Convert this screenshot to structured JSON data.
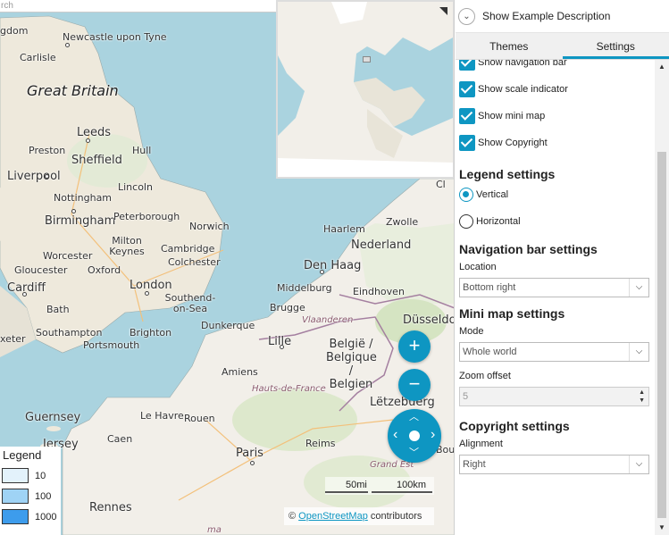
{
  "map": {
    "search_placeholder": "rch",
    "labels": {
      "great_britain": "Great Britain",
      "kingdom": "gdom",
      "newcastle": "Newcastle upon Tyne",
      "carlisle": "Carlisle",
      "leeds": "Leeds",
      "sheffield": "Sheffield",
      "preston": "Preston",
      "hull": "Hull",
      "liverpool": "Liverpool",
      "lincoln": "Lincoln",
      "nottingham": "Nottingham",
      "birmingham": "Birmingham",
      "peterborough": "Peterborough",
      "norwich": "Norwich",
      "milton_keynes": "Milton Keynes",
      "cambridge": "Cambridge",
      "worcester": "Worcester",
      "colchester": "Colchester",
      "gloucester": "Gloucester",
      "oxford": "Oxford",
      "cardiff": "Cardiff",
      "london": "London",
      "southend": "Southend-on-Sea",
      "bath": "Bath",
      "southampton": "Southampton",
      "brighton": "Brighton",
      "portsmouth": "Portsmouth",
      "dunkerque": "Dunkerque",
      "lille": "Lille",
      "belgie": "België / Belgique / Belgien",
      "vlaanderen": "Vlaanderen",
      "brugge": "Brugge",
      "middelburg": "Middelburg",
      "den_haag": "Den Haag",
      "nederland": "Nederland",
      "haarlem": "Haarlem",
      "zwolle": "Zwolle",
      "eindhoven": "Eindhoven",
      "dusseldorf": "Düsseldorf",
      "letzebuerg": "Lëtzebuerg",
      "hauts_de_france": "Hauts-de-France",
      "amiens": "Amiens",
      "le_havre": "Le Havre",
      "rouen": "Rouen",
      "caen": "Caen",
      "reims": "Reims",
      "paris": "Paris",
      "grand_est": "Grand Est",
      "rennes": "Rennes",
      "guernsey": "Guernsey",
      "jersey": "Jersey",
      "exeter": "xeter",
      "bordeaux_edge": "Bou",
      "north_sea_fragment": "Cl",
      "ice": "ma"
    }
  },
  "minimap": {
    "mode_icon": "collapse-corner-icon"
  },
  "navigation": {
    "zoom_in": "+",
    "zoom_out": "−",
    "pan_up": "︿",
    "pan_down": "﹀",
    "pan_left": "‹",
    "pan_right": "›"
  },
  "scale": {
    "imperial": "50mi",
    "metric": "100km"
  },
  "copyright": {
    "prefix": "© ",
    "link": "OpenStreetMap",
    "suffix": " contributors"
  },
  "legend": {
    "title": "Legend",
    "items": [
      {
        "label": "10",
        "color": "#e3f2fb"
      },
      {
        "label": "100",
        "color": "#9fd3f5"
      },
      {
        "label": "1000",
        "color": "#3d9cec"
      }
    ]
  },
  "panel": {
    "description_label": "Show Example Description",
    "tabs": [
      {
        "label": "Themes"
      },
      {
        "label": "Settings"
      }
    ],
    "checkboxes": [
      {
        "label": "Show navigation bar"
      },
      {
        "label": "Show scale indicator"
      },
      {
        "label": "Show mini map"
      },
      {
        "label": "Show Copyright"
      }
    ],
    "legend_settings": {
      "title": "Legend settings",
      "options": [
        {
          "label": "Vertical"
        },
        {
          "label": "Horizontal"
        }
      ]
    },
    "navbar_settings": {
      "title": "Navigation bar settings",
      "location_label": "Location",
      "location_value": "Bottom right"
    },
    "minimap_settings": {
      "title": "Mini map settings",
      "mode_label": "Mode",
      "mode_value": "Whole world",
      "zoom_offset_label": "Zoom offset",
      "zoom_offset_value": "5"
    },
    "copyright_settings": {
      "title": "Copyright settings",
      "alignment_label": "Alignment",
      "alignment_value": "Right"
    }
  },
  "colors": {
    "accent": "#0e96c2",
    "water": "#aad3df",
    "land": "#f2efe9"
  }
}
